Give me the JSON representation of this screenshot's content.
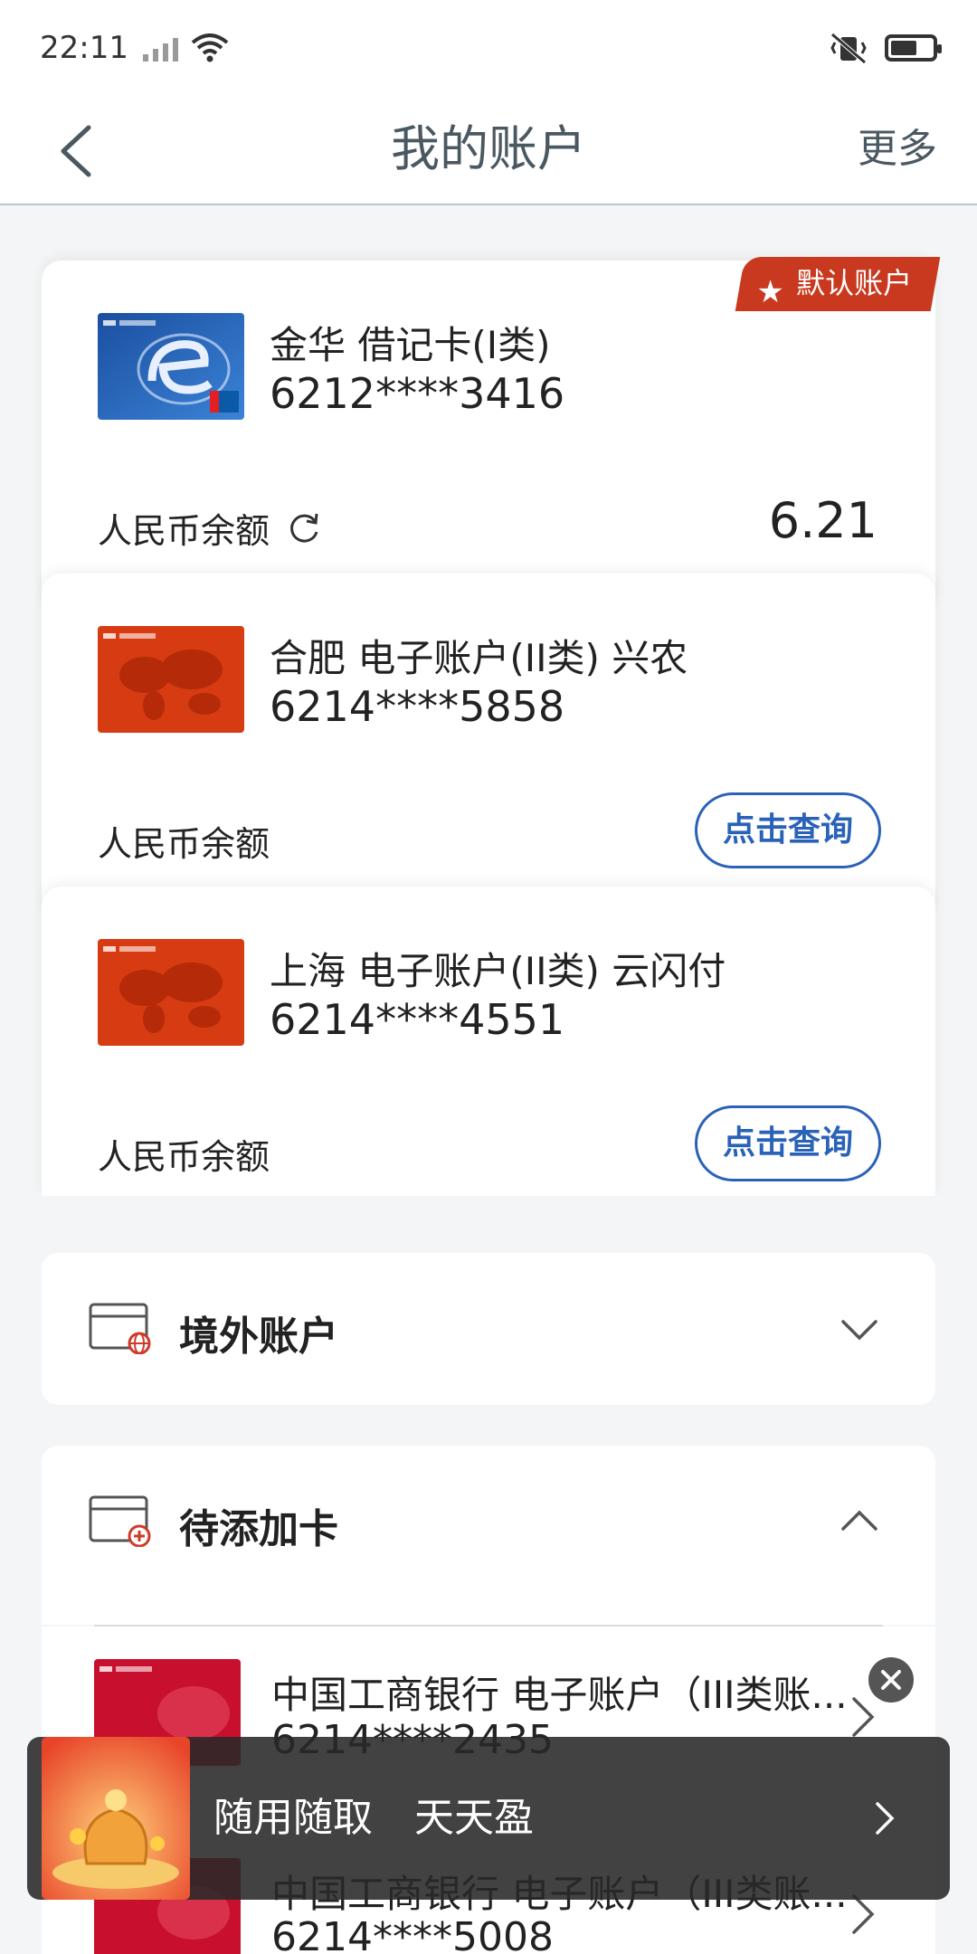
{
  "status": {
    "time": "22:11"
  },
  "nav": {
    "title": "我的账户",
    "more": "更多"
  },
  "accounts": [
    {
      "badge": "默认账户",
      "name": "金华 借记卡(I类)",
      "number": "6212****3416",
      "balance_label": "人民币余额",
      "balance": "6.21"
    },
    {
      "name": "合肥 电子账户(II类) 兴农",
      "number": "6214****5858",
      "balance_label": "人民币余额",
      "query": "点击查询"
    },
    {
      "name": "上海 电子账户(II类) 云闪付",
      "number": "6214****4551",
      "balance_label": "人民币余额",
      "query": "点击查询"
    }
  ],
  "sections": {
    "overseas": {
      "title": "境外账户"
    },
    "pending": {
      "title": "待添加卡"
    }
  },
  "pending_cards": [
    {
      "name": "中国工商银行 电子账户（III类账...",
      "number": "6214****2435"
    },
    {
      "name": "中国工商银行 电子账户（III类账...",
      "number": "6214****5008"
    }
  ],
  "banner": {
    "text1": "随用随取",
    "text2": "天天盈"
  },
  "colors": {
    "accent_blue": "#2a62b8",
    "badge_red": "#c8391f"
  }
}
